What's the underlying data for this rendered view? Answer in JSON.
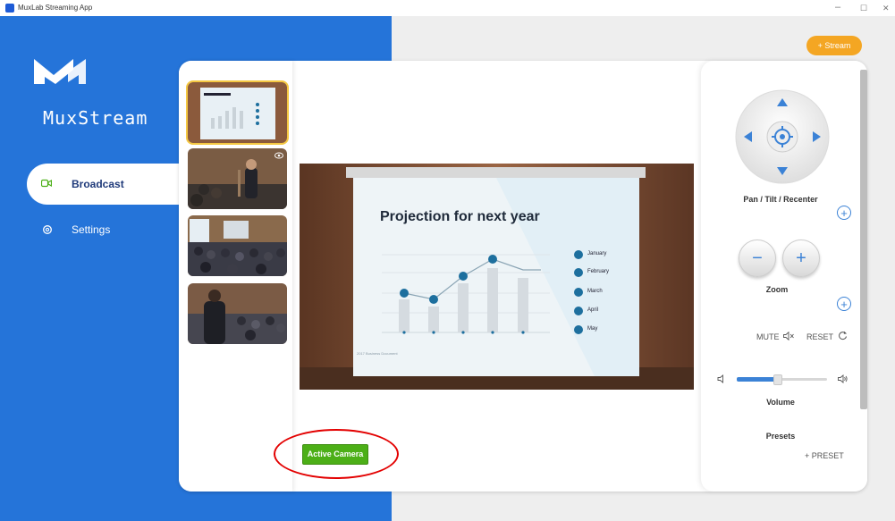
{
  "window": {
    "title": "MuxLab Streaming App",
    "controls": {
      "minimize": "–",
      "maximize": "☐",
      "close": "✕"
    }
  },
  "brand": {
    "name": "MuxStream"
  },
  "sidebar": {
    "items": [
      {
        "label": "Broadcast",
        "icon": "camera-icon",
        "active": true
      },
      {
        "label": "Settings",
        "icon": "gear-icon",
        "active": false
      }
    ]
  },
  "toolbar": {
    "stream_label": "+ Stream"
  },
  "thumbnails": [
    {
      "name": "thumb-projection-slide",
      "active": true
    },
    {
      "name": "thumb-speaker",
      "active": false,
      "icon": "eye-icon"
    },
    {
      "name": "thumb-audience",
      "active": false
    },
    {
      "name": "thumb-presenter-back",
      "active": false
    }
  ],
  "preview": {
    "slide_title": "Projection for next year",
    "legend": [
      "January",
      "February",
      "March",
      "April",
      "May"
    ],
    "footer": "2017 Business Document"
  },
  "active_camera_label": "Active Camera",
  "controls": {
    "ptz_label": "Pan / Tilt / Recenter",
    "zoom_label": "Zoom",
    "zoom_minus": "−",
    "zoom_plus": "+",
    "add_symbol": "+",
    "mute_label": "MUTE",
    "reset_label": "RESET",
    "volume_label": "Volume",
    "volume_level": 0.45,
    "presets_label": "Presets",
    "add_preset_label": "+  PRESET"
  },
  "colors": {
    "sidebar_blue": "#2574d9",
    "stream_orange": "#f4a623",
    "active_green": "#4caf17",
    "accent_blue": "#3b82d6",
    "highlight_red": "#e30000"
  }
}
